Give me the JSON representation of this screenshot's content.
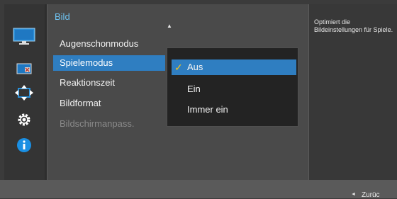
{
  "menu": {
    "title": "Bild",
    "scroll_indicator": "▲",
    "items": [
      {
        "label": "Augenschonmodus"
      },
      {
        "label": "Spielemodus"
      },
      {
        "label": "Reaktionszeit"
      },
      {
        "label": "Bildformat"
      },
      {
        "label": "Bildschirmanpass."
      }
    ]
  },
  "submenu": {
    "options": [
      {
        "label": "Aus",
        "checked": true
      },
      {
        "label": "Ein"
      },
      {
        "label": "Immer ein"
      }
    ],
    "check_mark": "✓"
  },
  "help": {
    "text": "Optimiert die Bildeinstellungen für Spiele."
  },
  "footer": {
    "back_arrow": "◄",
    "back_label": "Zurüc"
  },
  "sidebar_icons": [
    "picture-icon",
    "color-icon",
    "resize-icon",
    "settings-gear-icon",
    "info-icon"
  ],
  "colors": {
    "accent_blue": "#2f7ec1",
    "title_blue": "#6fc3f2",
    "check_yellow": "#f2c21b",
    "info_blue": "#1a8fe3"
  }
}
